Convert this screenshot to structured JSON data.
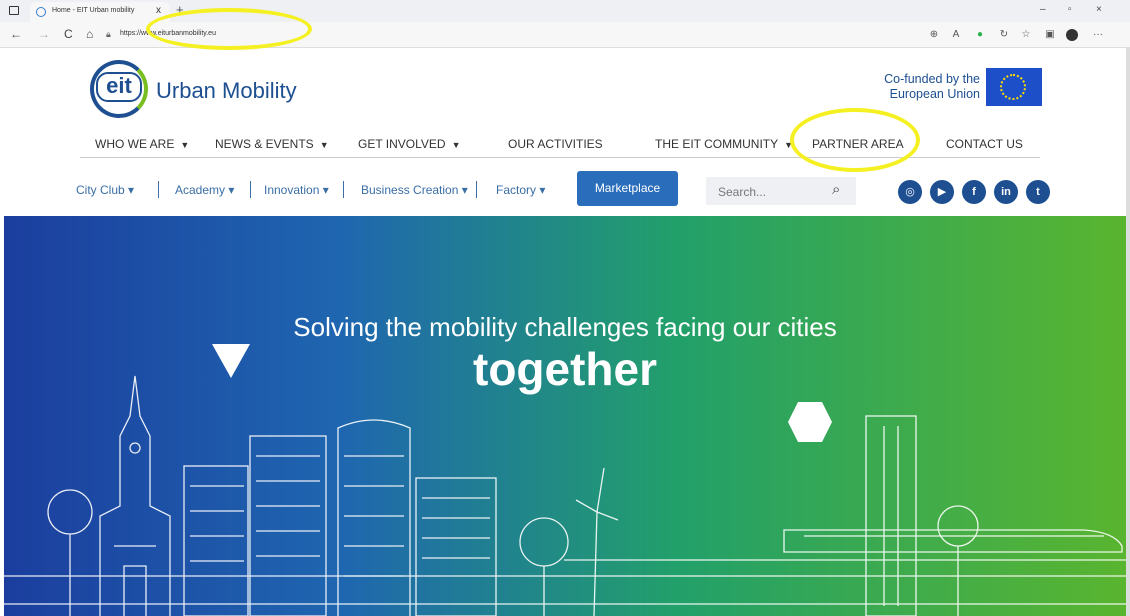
{
  "browser": {
    "tab_title": "Home - EIT Urban mobility",
    "tab_close": "x",
    "new_tab": "+",
    "url": "https://www.eiturbanmobility.eu",
    "nav": {
      "back": "←",
      "forward": "→",
      "reload": "C",
      "home": "⌂"
    },
    "window": {
      "minimize": "–",
      "restore": "▫",
      "close": "×"
    }
  },
  "site": {
    "logo_mark": "eit",
    "logo_text": "Urban Mobility",
    "cofunded_line1": "Co-funded by the",
    "cofunded_line2": "European Union"
  },
  "main_nav": [
    {
      "label": "WHO WE ARE",
      "dropdown": true
    },
    {
      "label": "NEWS & EVENTS",
      "dropdown": true
    },
    {
      "label": "GET INVOLVED",
      "dropdown": true
    },
    {
      "label": "OUR ACTIVITIES",
      "dropdown": false
    },
    {
      "label": "THE EIT COMMUNITY",
      "dropdown": true
    },
    {
      "label": "PARTNER AREA",
      "dropdown": false
    },
    {
      "label": "CONTACT US",
      "dropdown": false
    }
  ],
  "sub_nav": [
    {
      "label": "City Club ▾"
    },
    {
      "label": "Academy ▾"
    },
    {
      "label": "Innovation ▾"
    },
    {
      "label": "Business Creation ▾"
    },
    {
      "label": "Factory ▾"
    }
  ],
  "marketplace_label": "Marketplace",
  "search": {
    "placeholder": "Search..."
  },
  "social": [
    "instagram-icon",
    "youtube-icon",
    "facebook-icon",
    "linkedin-icon",
    "twitter-icon"
  ],
  "hero": {
    "subtitle": "Solving the mobility challenges facing our cities",
    "title": "together"
  },
  "colors": {
    "brand_blue": "#1d4f91",
    "link_blue": "#3a6ea5",
    "button_blue": "#2a6ebb",
    "highlight": "#f5f021"
  }
}
